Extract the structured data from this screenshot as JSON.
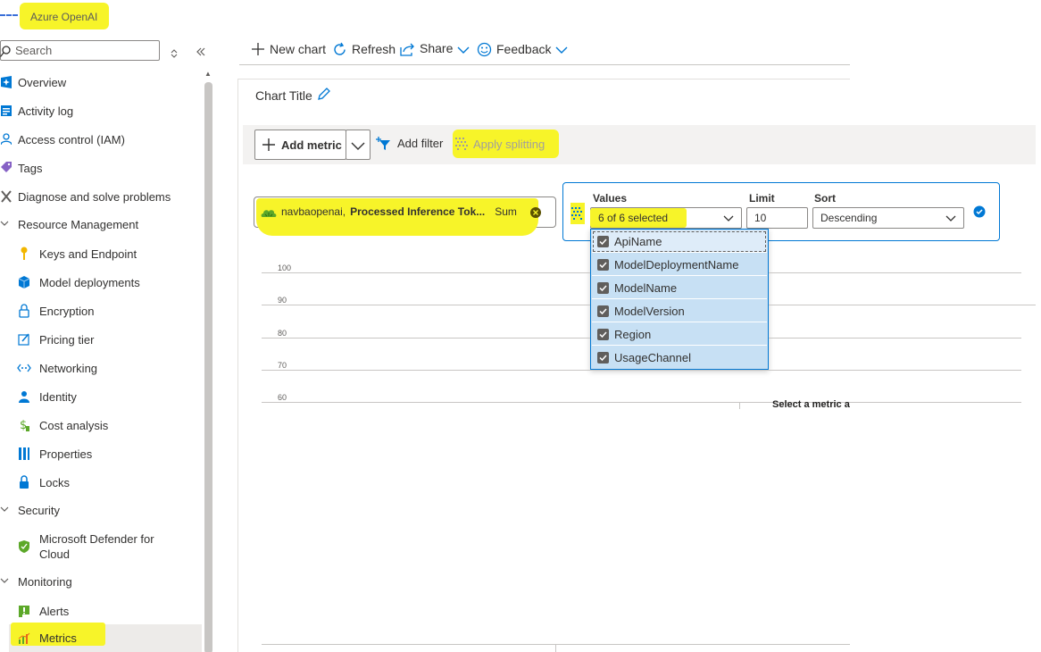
{
  "app": {
    "title": "Azure OpenAI"
  },
  "sidebar": {
    "search_placeholder": "Search",
    "top_items": [
      {
        "label": "Overview",
        "icon": "overview-icon"
      },
      {
        "label": "Activity log",
        "icon": "activity-log-icon"
      },
      {
        "label": "Access control (IAM)",
        "icon": "people-icon"
      },
      {
        "label": "Tags",
        "icon": "tag-icon"
      },
      {
        "label": "Diagnose and solve problems",
        "icon": "wrench-icon"
      }
    ],
    "groups": [
      {
        "label": "Resource Management",
        "items": [
          {
            "label": "Keys and Endpoint",
            "icon": "key-icon"
          },
          {
            "label": "Model deployments",
            "icon": "cube-icon"
          },
          {
            "label": "Encryption",
            "icon": "lock-icon"
          },
          {
            "label": "Pricing tier",
            "icon": "edit-square-icon"
          },
          {
            "label": "Networking",
            "icon": "network-icon"
          },
          {
            "label": "Identity",
            "icon": "identity-icon"
          },
          {
            "label": "Cost analysis",
            "icon": "dollar-icon"
          },
          {
            "label": "Properties",
            "icon": "properties-icon"
          },
          {
            "label": "Locks",
            "icon": "lock-icon"
          }
        ]
      },
      {
        "label": "Security",
        "items": [
          {
            "label": "Microsoft Defender for",
            "label2": "Cloud",
            "icon": "shield-icon"
          }
        ]
      },
      {
        "label": "Monitoring",
        "items": [
          {
            "label": "Alerts",
            "icon": "alert-icon"
          },
          {
            "label": "Metrics",
            "icon": "metrics-icon",
            "selected": true
          }
        ]
      }
    ]
  },
  "toolbar": {
    "new_chart": "New chart",
    "refresh": "Refresh",
    "share": "Share",
    "feedback": "Feedback"
  },
  "chart": {
    "title": "Chart Title",
    "add_metric": "Add metric",
    "add_filter": "Add filter",
    "apply_splitting": "Apply splitting",
    "metric_pill": {
      "resource": "navbaopenai,",
      "metric": "Processed Inference Tok...",
      "aggregation": "Sum"
    },
    "splitting": {
      "values_label": "Values",
      "values_selected": "6 of 6 selected",
      "limit_label": "Limit",
      "limit_value": "10",
      "sort_label": "Sort",
      "sort_value": "Descending",
      "options": [
        "ApiName",
        "ModelDeploymentName",
        "ModelName",
        "ModelVersion",
        "Region",
        "UsageChannel"
      ]
    },
    "y_ticks": [
      "100",
      "90",
      "80",
      "70",
      "60"
    ],
    "overlay_message": "Select a metric a"
  },
  "colors": {
    "highlight": "#f7f429",
    "accent": "#0078d4",
    "dropdown_bg": "#c7e0f4"
  }
}
